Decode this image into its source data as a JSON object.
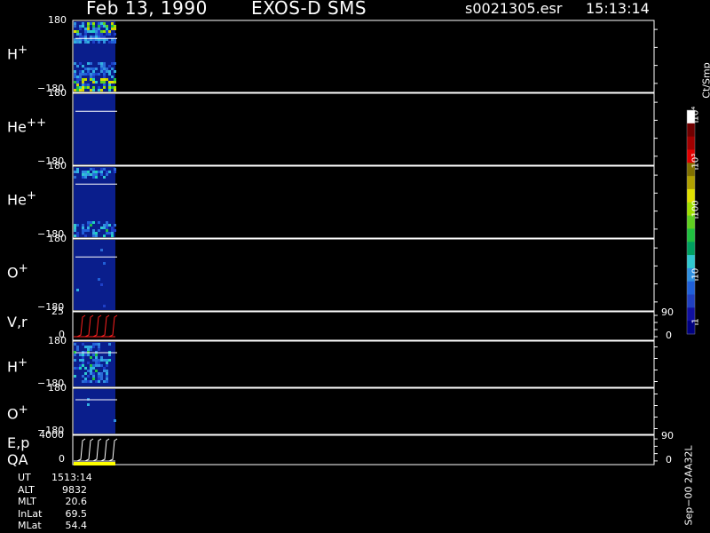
{
  "header": {
    "date": "Feb 13, 1990",
    "instrument": "EXOS-D SMS",
    "file": "s0021305.esr",
    "time": "15:13:14"
  },
  "chart_data": {
    "type": "heatmap",
    "panels": [
      {
        "id": "h_plus",
        "label_html": "H<sup>+</sup>",
        "ymax": "180",
        "ymin": "−180",
        "kind": "spectrogram"
      },
      {
        "id": "he_pp",
        "label_html": "He<sup>++</sup>",
        "ymax": "180",
        "ymin": "−180",
        "kind": "spectrogram"
      },
      {
        "id": "he_plus",
        "label_html": "He<sup>+</sup>",
        "ymax": "180",
        "ymin": "−180",
        "kind": "spectrogram"
      },
      {
        "id": "o_plus",
        "label_html": "O<sup>+</sup>",
        "ymax": "180",
        "ymin": "−180",
        "kind": "spectrogram"
      },
      {
        "id": "vr",
        "label_html": "V,r",
        "ymax": "25",
        "ymin": "0",
        "right_max": "90",
        "right_min": "0",
        "kind": "line"
      },
      {
        "id": "h_plus_2",
        "label_html": "H<sup>+</sup>",
        "ymax": "180",
        "ymin": "−180",
        "kind": "spectrogram"
      },
      {
        "id": "o_plus_2",
        "label_html": "O<sup>+</sup>",
        "ymax": "180",
        "ymin": "−180",
        "kind": "spectrogram"
      },
      {
        "id": "ep_qa",
        "label_html": "E,p<br>QA",
        "ymax": "4000",
        "ymin": "0",
        "right_max": "90",
        "right_min": "0",
        "kind": "line"
      }
    ],
    "colorbar": {
      "unit": "Ct/Smp",
      "ticks": [
        "1",
        "10",
        "100",
        "10³",
        "10⁴"
      ],
      "colors": [
        "#000080",
        "#1010a0",
        "#2040c0",
        "#2060d8",
        "#3090e0",
        "#30c8d0",
        "#00a060",
        "#20c040",
        "#60d020",
        "#a0e000",
        "#e0e000",
        "#b0a000",
        "#807000",
        "#e00000",
        "#a00000",
        "#700000",
        "#ffffff"
      ]
    }
  },
  "info": {
    "rows": [
      {
        "label": "UT",
        "value": "1513:14"
      },
      {
        "label": "ALT",
        "value": "9832"
      },
      {
        "label": "MLT",
        "value": "20.6"
      },
      {
        "label": "InLat",
        "value": "69.5"
      },
      {
        "label": "MLat",
        "value": "54.4"
      }
    ]
  },
  "footer": {
    "version": "Sep−00 2AA32L"
  }
}
